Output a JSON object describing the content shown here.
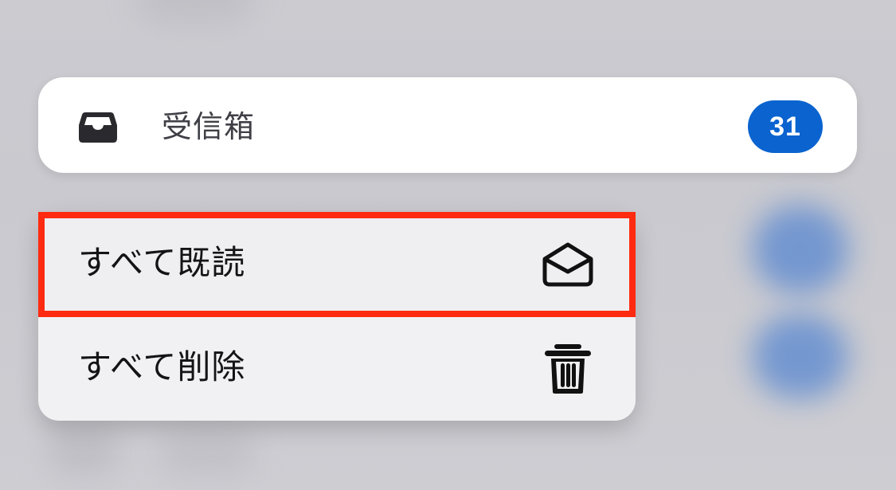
{
  "preview": {
    "title": "受信箱",
    "unread_count": "31",
    "icon": "inbox-tray-icon"
  },
  "menu": {
    "items": [
      {
        "label": "すべて既読",
        "icon": "envelope-open-icon"
      },
      {
        "label": "すべて削除",
        "icon": "trash-icon"
      }
    ]
  },
  "colors": {
    "badge": "#0a63cf",
    "highlight": "#ff2b10",
    "menu_bg": "#f0f0f2",
    "card_bg": "#ffffff",
    "backdrop": "#cfcfd4"
  }
}
